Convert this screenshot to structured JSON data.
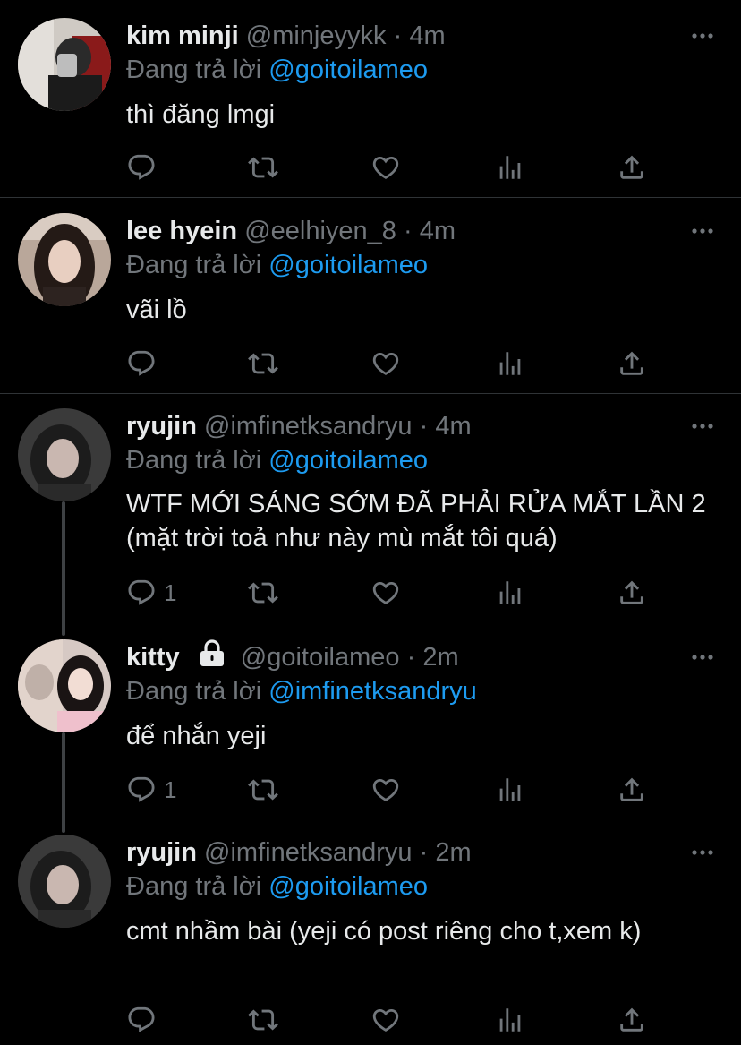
{
  "reply_prefix": "Đang trả lời",
  "tweets": [
    {
      "name": "kim minji",
      "handle": "@minjeyykk",
      "sep": "·",
      "time": "4m",
      "reply_to": "@goitoilameo",
      "text": "thì đăng lmgi",
      "reply_count": ""
    },
    {
      "name": "lee hyein",
      "handle": "@eelhiyen_8",
      "sep": "·",
      "time": "4m",
      "reply_to": "@goitoilameo",
      "text": "vãi lồ",
      "reply_count": ""
    },
    {
      "name": "ryujin",
      "handle": "@imfinetksandryu",
      "sep": "·",
      "time": "4m",
      "reply_to": "@goitoilameo",
      "text": "WTF MỚI SÁNG SỚM ĐÃ PHẢI RỬA MẮT LẦN 2 (mặt trời toả như này mù mắt tôi quá)",
      "reply_count": "1"
    },
    {
      "name": "kitty",
      "handle": "@goitoilameo",
      "sep": "·",
      "time": "2m",
      "reply_to": "@imfinetksandryu",
      "text": "để nhắn yeji",
      "reply_count": "1",
      "locked_icon": "lock-icon"
    },
    {
      "name": "ryujin",
      "handle": "@imfinetksandryu",
      "sep": "·",
      "time": "2m",
      "reply_to": "@goitoilameo",
      "text": "cmt nhầm bài (yeji có post riêng cho t,xem k)",
      "reply_count": ""
    }
  ],
  "icons": {
    "reply": "reply-icon",
    "retweet": "retweet-icon",
    "like": "heart-icon",
    "views": "views-icon",
    "share": "share-icon",
    "more": "more-icon"
  },
  "colors": {
    "background": "#000000",
    "text": "#e7e9ea",
    "muted": "#71767b",
    "link": "#1d9bf0",
    "divider": "#2f3336",
    "thread_line": "#3e4144"
  }
}
